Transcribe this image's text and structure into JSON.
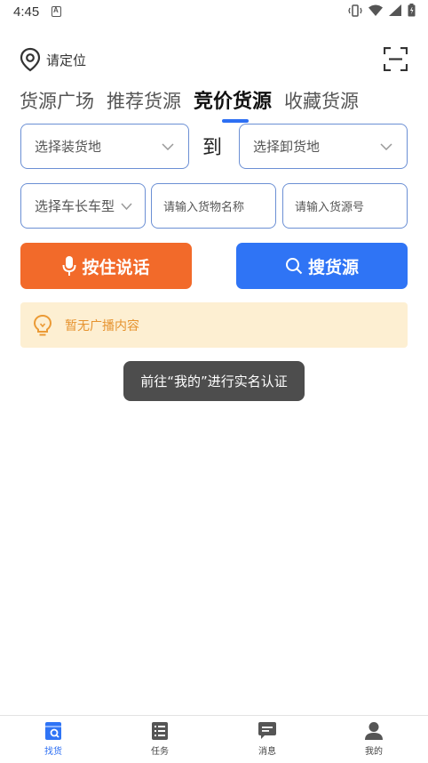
{
  "status_bar": {
    "time": "4:45",
    "a_badge": "A"
  },
  "location": {
    "label": "请定位",
    "icon": "location-pin-icon"
  },
  "scan_icon": "scan-icon",
  "tabs": [
    {
      "label": "货源广场",
      "active": false
    },
    {
      "label": "推荐货源",
      "active": false
    },
    {
      "label": "竞价货源",
      "active": true
    },
    {
      "label": "收藏货源",
      "active": false
    }
  ],
  "filters": {
    "load_place": "选择装货地",
    "to_label": "到",
    "unload_place": "选择卸货地",
    "vehicle": "选择车长车型",
    "goods_name_placeholder": "请输入货物名称",
    "source_no_placeholder": "请输入货源号"
  },
  "buttons": {
    "voice": "按住说话",
    "search": "搜货源"
  },
  "broadcast": {
    "text": "暂无广播内容"
  },
  "toast": {
    "text": "前往“我的”进行实名认证"
  },
  "bottom_nav": [
    {
      "label": "找货",
      "icon": "find-goods-icon",
      "active": true
    },
    {
      "label": "任务",
      "icon": "task-list-icon",
      "active": false
    },
    {
      "label": "消息",
      "icon": "message-icon",
      "active": false
    },
    {
      "label": "我的",
      "icon": "profile-icon",
      "active": false
    }
  ],
  "colors": {
    "accent_blue": "#2f74f5",
    "voice_orange": "#f26a2a",
    "broadcast_bg": "#fdefd2",
    "broadcast_text": "#e6932f",
    "field_border": "#6b8fd4"
  }
}
